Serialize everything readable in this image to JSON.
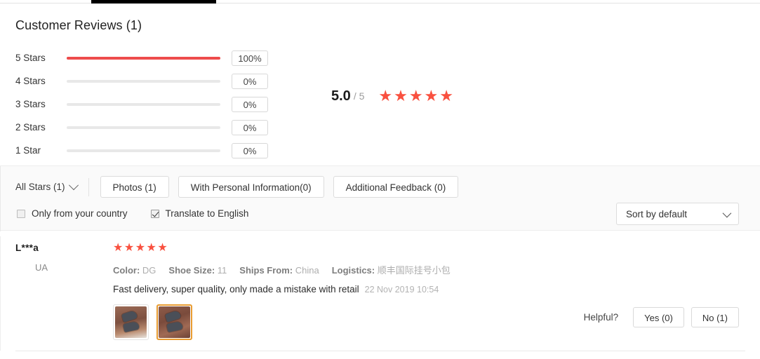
{
  "header": {
    "title": "Customer Reviews (1)"
  },
  "rating_summary": {
    "score": "5.0",
    "out_of": "/ 5",
    "stars_glyph": "★★★★★",
    "accent_color": "#ee4c4c",
    "star_color": "#f9503f",
    "breakdown": [
      {
        "label": "5 Stars",
        "percent_label": "100%",
        "percent": 100
      },
      {
        "label": "4 Stars",
        "percent_label": "0%",
        "percent": 0
      },
      {
        "label": "3 Stars",
        "percent_label": "0%",
        "percent": 0
      },
      {
        "label": "2 Stars",
        "percent_label": "0%",
        "percent": 0
      },
      {
        "label": "1 Star",
        "percent_label": "0%",
        "percent": 0
      }
    ]
  },
  "filters": {
    "all_stars_label": "All Stars (1)",
    "chevron_icon": "chevron-down-icon",
    "pills": [
      {
        "label": "Photos (1)"
      },
      {
        "label": "With Personal Information(0)"
      },
      {
        "label": "Additional Feedback (0)"
      }
    ],
    "checkboxes": [
      {
        "label": "Only from your country",
        "checked": false
      },
      {
        "label": "Translate to English",
        "checked": true
      }
    ],
    "sort": {
      "value": "Sort by default",
      "chevron_icon": "chevron-down-icon"
    }
  },
  "review": {
    "author": "L***a",
    "country_code": "UA",
    "flag_icon": "ukraine-flag-icon",
    "stars_glyph": "★★★★★",
    "attributes": [
      {
        "key": "Color:",
        "value": "DG"
      },
      {
        "key": "Shoe Size:",
        "value": "11"
      },
      {
        "key": "Ships From:",
        "value": "China"
      },
      {
        "key": "Logistics:",
        "value": "顺丰国际挂号小包"
      }
    ],
    "text": "Fast delivery, super quality, only made a mistake with retail",
    "date": "22 Nov 2019 10:54",
    "photos": [
      {
        "alt": "review-photo-1",
        "selected": false
      },
      {
        "alt": "review-photo-2",
        "selected": true
      }
    ],
    "helpful": {
      "label": "Helpful?",
      "yes_label": "Yes (0)",
      "no_label": "No (1)"
    }
  }
}
